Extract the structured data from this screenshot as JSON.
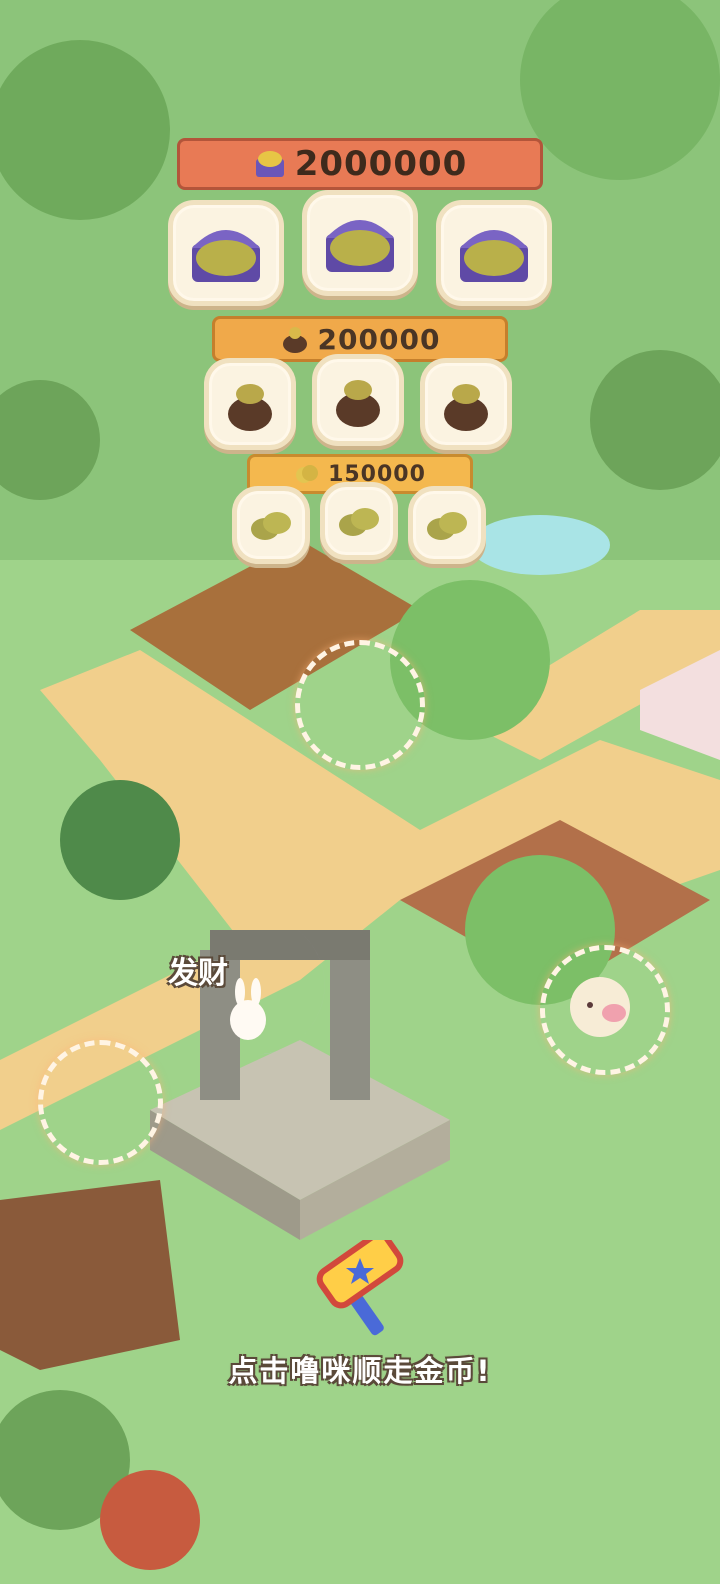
{
  "rewards": {
    "tier1": {
      "amount": "2000000",
      "icon": "treasure-chest-icon",
      "slots": 3
    },
    "tier2": {
      "amount": "200000",
      "icon": "coin-bag-icon",
      "slots": 3
    },
    "tier3": {
      "amount": "150000",
      "icon": "coin-stack-icon",
      "slots": 3
    }
  },
  "scene": {
    "portal_label": "发财",
    "hint_text": "点击噜咪顺走金币!"
  },
  "colors": {
    "grass": "#9fd38a",
    "path": "#f1cf8c",
    "banner_tier1": "#e87a55",
    "banner_tier2": "#f0a94a",
    "banner_tier3": "#f4b84e"
  }
}
